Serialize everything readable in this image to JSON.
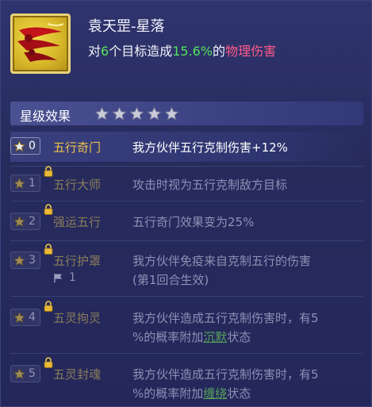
{
  "skill": {
    "icon": "comet-fire-icon",
    "name": "袁天罡-星落",
    "desc_prefix": "对",
    "desc_targets": "6",
    "desc_mid": "个目标造成",
    "desc_percent": "15.6%",
    "desc_of": "的",
    "desc_damage_type": "物理伤害"
  },
  "star_section": {
    "title": "星级效果",
    "stars": 5
  },
  "rows": [
    {
      "level": "0",
      "name": "五行奇门",
      "desc": "我方伙伴五行克制伤害+12%",
      "active": true,
      "locked": false
    },
    {
      "level": "1",
      "name": "五行大师",
      "desc": "攻击时视为五行克制敌方目标",
      "active": false,
      "locked": true
    },
    {
      "level": "2",
      "name": "强运五行",
      "desc": "五行奇门效果变为25%",
      "active": false,
      "locked": true
    },
    {
      "level": "3",
      "name": "五行护罩",
      "desc_line1": "我方伙伴免疫来自克制五行的伤害",
      "desc_line2": "(第1回合生效)",
      "flag_count": "1",
      "active": false,
      "locked": true
    },
    {
      "level": "4",
      "name": "五灵拘灵",
      "desc_line1": "我方伙伴造成五行克制伤害时，有5",
      "desc_line2_a": "%的概率附加",
      "desc_line2_status": "沉默",
      "desc_line2_b": "状态",
      "active": false,
      "locked": true
    },
    {
      "level": "5",
      "name": "五灵封魂",
      "desc_line1": "我方伙伴造成五行克制伤害时，有5",
      "desc_line2_a": "%的概率附加",
      "desc_line2_status": "缠绕",
      "desc_line2_b": "状态",
      "active": false,
      "locked": true
    }
  ],
  "colors": {
    "background": "#2b2f63",
    "highlight_green": "#54e35a",
    "damage_pink": "#ff5a8a",
    "active_name_gold": "#f0c24a"
  }
}
